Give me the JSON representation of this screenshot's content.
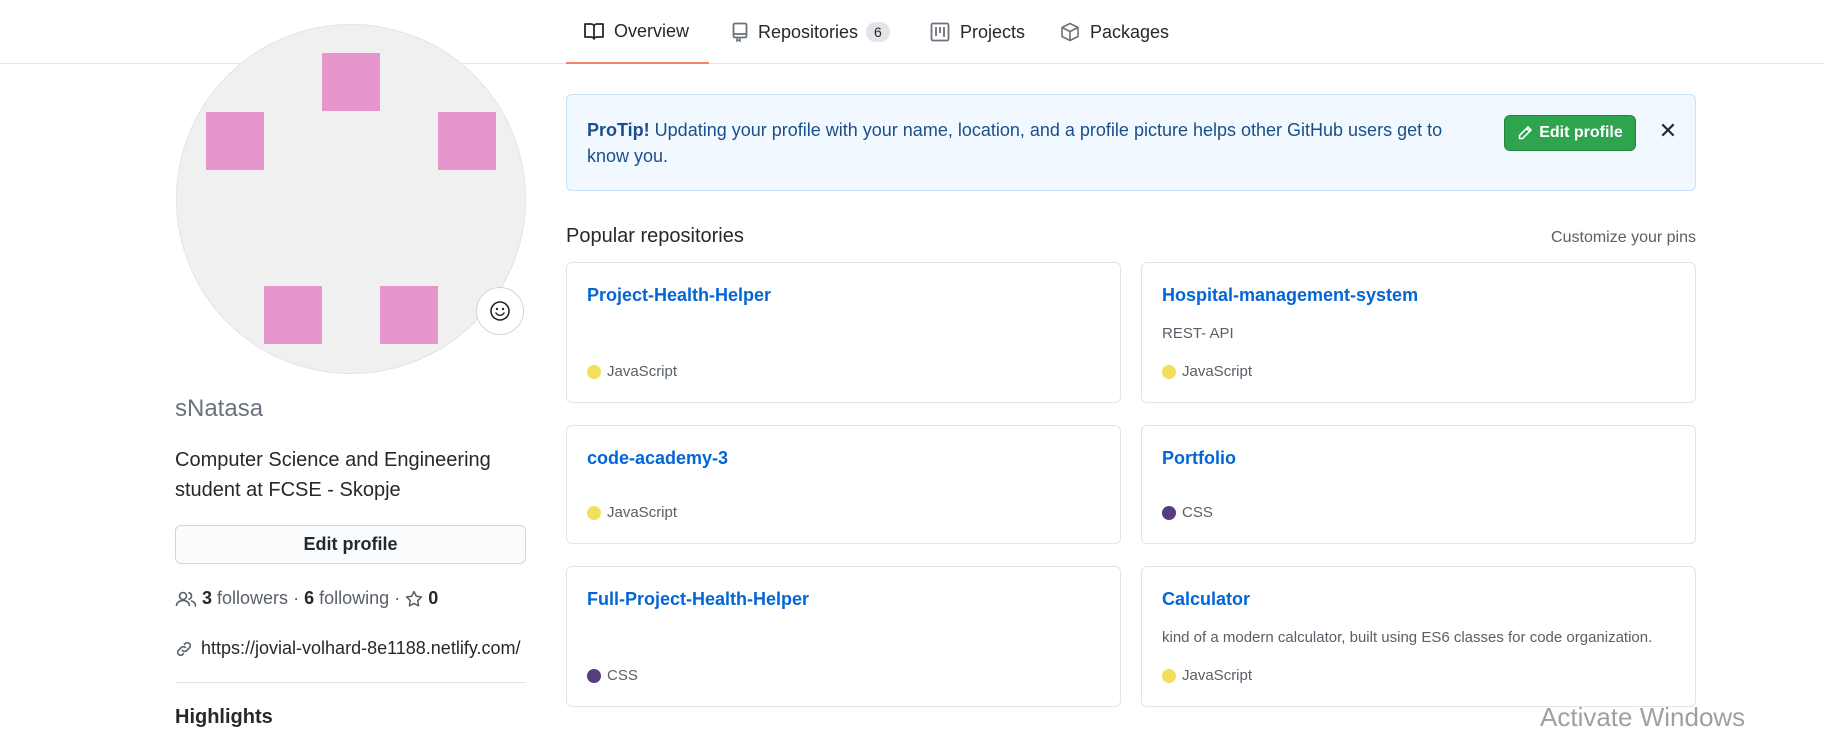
{
  "tabs": [
    {
      "label": "Overview",
      "icon": "book-icon",
      "active": true
    },
    {
      "label": "Repositories",
      "icon": "repo-icon",
      "count": "6"
    },
    {
      "label": "Projects",
      "icon": "project-icon"
    },
    {
      "label": "Packages",
      "icon": "package-icon"
    }
  ],
  "profile": {
    "username": "sNatasa",
    "bio": "Computer Science and Engineering student at FCSE - Skopje",
    "edit_label": "Edit profile",
    "followers_count": "3",
    "followers_label": "followers",
    "following_count": "6",
    "following_label": "following",
    "stars_count": "0",
    "sep": "·",
    "website": "https://jovial-volhard-8e1188.netlify.com/",
    "highlights_label": "Highlights",
    "avatar_color": "#e597cd"
  },
  "protip": {
    "title": "ProTip!",
    "message": " Updating your profile with your name, location, and a profile picture helps other GitHub users get to know you.",
    "button_label": "Edit profile",
    "close_glyph": "✕"
  },
  "popular": {
    "title": "Popular repositories",
    "customize_label": "Customize your pins",
    "repos": [
      {
        "name": "Project-Health-Helper",
        "description": "",
        "language": "JavaScript",
        "lang_color": "#f1e05a"
      },
      {
        "name": "Hospital-management-system",
        "description": "REST- API",
        "language": "JavaScript",
        "lang_color": "#f1e05a"
      },
      {
        "name": "code-academy-3",
        "description": "",
        "language": "JavaScript",
        "lang_color": "#f1e05a"
      },
      {
        "name": "Portfolio",
        "description": "",
        "language": "CSS",
        "lang_color": "#563d7c"
      },
      {
        "name": "Full-Project-Health-Helper",
        "description": "",
        "language": "CSS",
        "lang_color": "#563d7c"
      },
      {
        "name": "Calculator",
        "description": "kind of a modern calculator, built using ES6 classes for code organization.",
        "language": "JavaScript",
        "lang_color": "#f1e05a"
      }
    ]
  },
  "watermark": "Activate Windows"
}
